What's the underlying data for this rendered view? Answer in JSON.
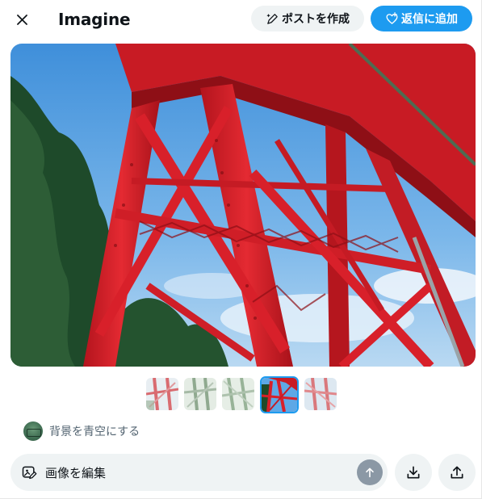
{
  "header": {
    "title": "Imagine",
    "close_icon": "close-icon",
    "post_button_label": "ポストを作成",
    "post_button_icon": "sparkle-pen-icon",
    "reply_button_label": "返信に追加",
    "reply_button_icon": "heart-plus-icon"
  },
  "main_image": {
    "subject": "red steel railway bridge truss against blue sky"
  },
  "thumbnails": [
    {
      "icon": "thumbnail-1",
      "selected": false
    },
    {
      "icon": "thumbnail-2",
      "selected": false
    },
    {
      "icon": "thumbnail-3",
      "selected": false
    },
    {
      "icon": "thumbnail-4",
      "selected": true
    },
    {
      "icon": "thumbnail-5",
      "selected": false
    }
  ],
  "prompt": {
    "text": "背景を青空にする"
  },
  "edit_bar": {
    "value": "画像を編集",
    "icon": "image-edit-icon",
    "send_icon": "arrow-up-icon"
  },
  "actions": {
    "download_icon": "download-icon",
    "share_icon": "share-icon"
  },
  "colors": {
    "accent": "#1d9bf0",
    "pill_bg": "#eff3f4",
    "secondary_text": "#536471",
    "bridge_red": "#d8202a",
    "sky_blue": "#5ea8e6"
  }
}
